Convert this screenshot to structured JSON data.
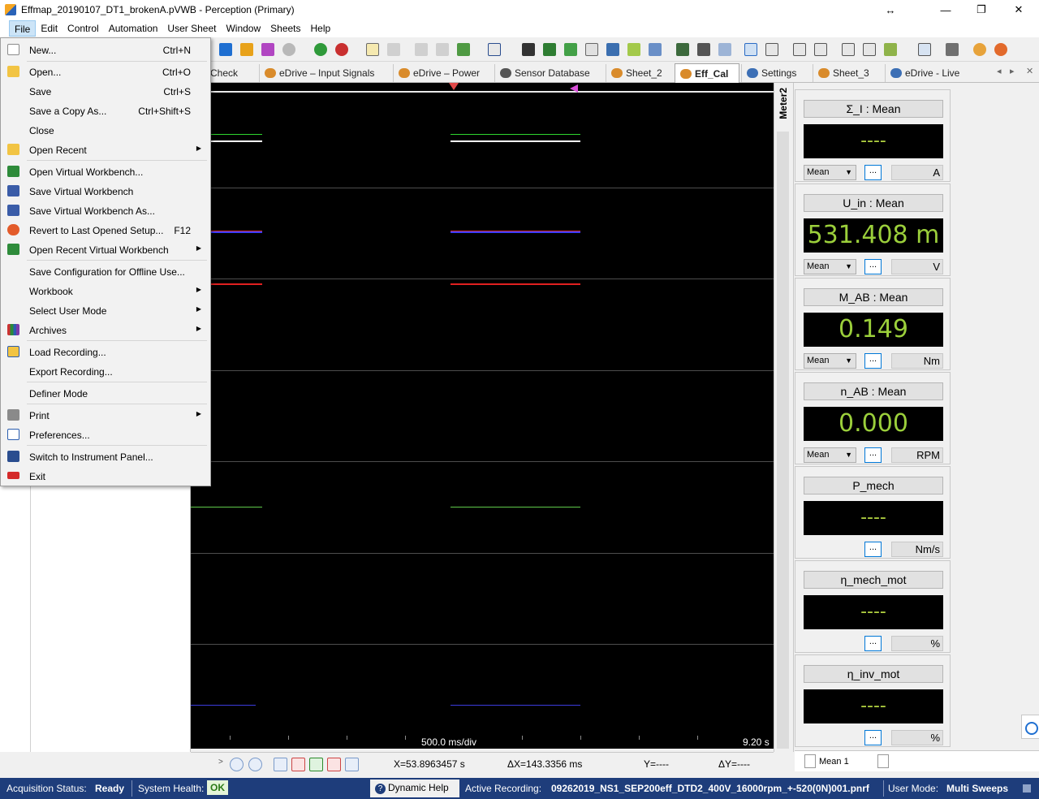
{
  "window": {
    "title": "Effmap_20190107_DT1_brokenA.pVWB - Perception (Primary)",
    "buttons": {
      "restore_special": "↔",
      "minimize": "—",
      "maximize": "❐",
      "close": "✕"
    }
  },
  "menubar": [
    "File",
    "Edit",
    "Control",
    "Automation",
    "User Sheet",
    "Window",
    "Sheets",
    "Help"
  ],
  "tabs": [
    {
      "label": "Check"
    },
    {
      "label": "eDrive – Input Signals"
    },
    {
      "label": "eDrive – Power"
    },
    {
      "label": "Sensor Database"
    },
    {
      "label": "Sheet_2"
    },
    {
      "label": "Eff_Cal"
    },
    {
      "label": "Settings"
    },
    {
      "label": "Sheet_3"
    },
    {
      "label": "eDrive - Live"
    }
  ],
  "tab_nav": {
    "prev": "◂",
    "next": "▸",
    "close": "✕"
  },
  "file_menu": {
    "items": [
      {
        "label": "New...",
        "shortcut": "Ctrl+N",
        "icon": "new-file-icon"
      },
      {
        "label": "Open...",
        "shortcut": "Ctrl+O",
        "icon": "open-folder-icon"
      },
      {
        "label": "Save",
        "shortcut": "Ctrl+S",
        "icon": ""
      },
      {
        "label": "Save a Copy As...",
        "shortcut": "Ctrl+Shift+S",
        "icon": ""
      },
      {
        "label": "Close",
        "shortcut": "",
        "icon": ""
      },
      {
        "label": "Open Recent",
        "shortcut": "",
        "icon": "open-recent-icon",
        "submenu": true
      },
      {
        "label": "Open Virtual Workbench...",
        "shortcut": "",
        "icon": "workbench-open-icon"
      },
      {
        "label": "Save Virtual Workbench",
        "shortcut": "",
        "icon": "workbench-save-icon"
      },
      {
        "label": "Save Virtual Workbench As...",
        "shortcut": "",
        "icon": "workbench-save-as-icon"
      },
      {
        "label": "Revert to Last Opened Setup...",
        "shortcut": "F12",
        "icon": "revert-icon"
      },
      {
        "label": "Open Recent Virtual Workbench",
        "shortcut": "",
        "icon": "workbench-recent-icon",
        "submenu": true
      },
      {
        "label": "Save Configuration for Offline Use...",
        "shortcut": "",
        "icon": ""
      },
      {
        "label": "Workbook",
        "shortcut": "",
        "icon": "",
        "submenu": true
      },
      {
        "label": "Select User Mode",
        "shortcut": "",
        "icon": "",
        "submenu": true
      },
      {
        "label": "Archives",
        "shortcut": "",
        "icon": "archives-icon",
        "submenu": true
      },
      {
        "label": "Load Recording...",
        "shortcut": "",
        "icon": "load-recording-icon"
      },
      {
        "label": "Export Recording...",
        "shortcut": "",
        "icon": ""
      },
      {
        "label": "Definer Mode",
        "shortcut": "",
        "icon": ""
      },
      {
        "label": "Print",
        "shortcut": "",
        "icon": "print-icon",
        "submenu": true
      },
      {
        "label": "Preferences...",
        "shortcut": "",
        "icon": "preferences-icon"
      },
      {
        "label": "Switch to Instrument Panel...",
        "shortcut": "",
        "icon": "instrument-panel-icon"
      },
      {
        "label": "Exit",
        "shortcut": "",
        "icon": "exit-icon"
      }
    ],
    "submenu_glyph": "▶"
  },
  "scope": {
    "time_base": "500.0 ms/div",
    "time_end": "9.20 s"
  },
  "meter_panel": {
    "title": "Meter2",
    "meters": [
      {
        "title": "Σ_I : Mean",
        "value": "----",
        "mode": "Mean",
        "unit": "A",
        "button": "..."
      },
      {
        "title": "U_in : Mean",
        "value": "531.408 m",
        "mode": "Mean",
        "unit": "V",
        "button": "..."
      },
      {
        "title": "M_AB : Mean",
        "value": "0.149",
        "mode": "Mean",
        "unit": "Nm",
        "button": "..."
      },
      {
        "title": "n_AB : Mean",
        "value": "0.000",
        "mode": "Mean",
        "unit": "RPM",
        "button": "..."
      },
      {
        "title": "P_mech",
        "value": "----",
        "mode": "",
        "unit": "Nm/s",
        "button": "..."
      },
      {
        "title": "η_mech_mot",
        "value": "----",
        "mode": "",
        "unit": "%",
        "button": "..."
      },
      {
        "title": "η_inv_mot",
        "value": "----",
        "mode": "",
        "unit": "%",
        "button": "..."
      }
    ],
    "footer_field": "Mean 1"
  },
  "cursor_readouts": {
    "x": "X=53.8963457 s",
    "dx": "ΔX=143.3356 ms",
    "y": "Y=----",
    "dy": "ΔY=----"
  },
  "statusbar": {
    "acq_label": "Acquisition Status:",
    "acq_value": "Ready",
    "health_label": "System Health:",
    "health_value": "OK",
    "help_label": "Dynamic Help",
    "recording_label": "Active Recording:",
    "recording_value": "09262019_NS1_SEP200eff_DTD2_400V_16000rpm_+-520(0N)001.pnrf",
    "usermode_label": "User Mode:",
    "usermode_value": "Multi Sweeps"
  },
  "colors": {
    "statusbar_bg": "#1e3d7b",
    "scope_bg": "#000000",
    "meter_green": "#9bcf3b"
  }
}
